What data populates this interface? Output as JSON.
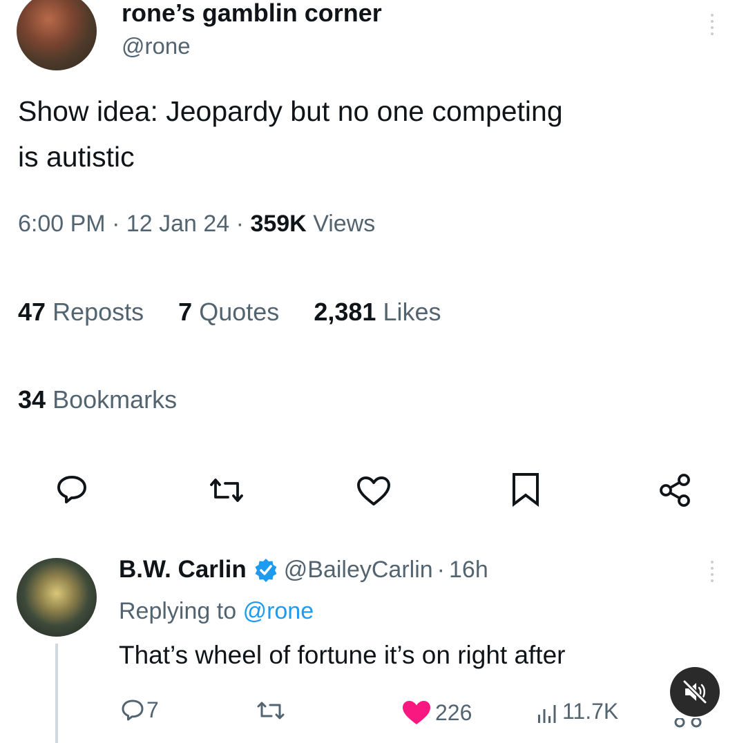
{
  "tweet": {
    "author_name": "rone’s gamblin corner",
    "author_handle": "@rone",
    "text_line1": "Show idea: Jeopardy but no one competing",
    "text_line2": "is autistic",
    "time": "6:00 PM",
    "date": "12 Jan 24",
    "views_count": "359K",
    "views_label": "Views",
    "reposts_count": "47",
    "reposts_label": "Reposts",
    "quotes_count": "7",
    "quotes_label": "Quotes",
    "likes_count": "2,381",
    "likes_label": "Likes",
    "bookmarks_count": "34",
    "bookmarks_label": "Bookmarks",
    "separator": "·"
  },
  "reply": {
    "author_name": "B.W. Carlin",
    "author_handle": "@BaileyCarlin",
    "age": "16h",
    "replying_prefix": "Replying to",
    "replying_handle": "@rone",
    "text": "That’s wheel of fortune it’s on right after",
    "reply_count": "7",
    "like_count": "226",
    "view_count": "11.7K",
    "verified": true
  },
  "icons": {
    "reply": "comment-bubble-icon",
    "repost": "repost-arrows-icon",
    "like": "heart-icon",
    "bookmark": "bookmark-icon",
    "share": "share-nodes-icon",
    "more": "kebab-menu-icon",
    "views": "bar-chart-icon",
    "mute": "muted-speaker-icon",
    "verified": "verified-badge-icon"
  },
  "colors": {
    "text_primary": "#0f1419",
    "text_secondary": "#536471",
    "link_blue": "#1d9bf0",
    "like_pink": "#f91880",
    "verified_blue": "#1d9bf0"
  }
}
